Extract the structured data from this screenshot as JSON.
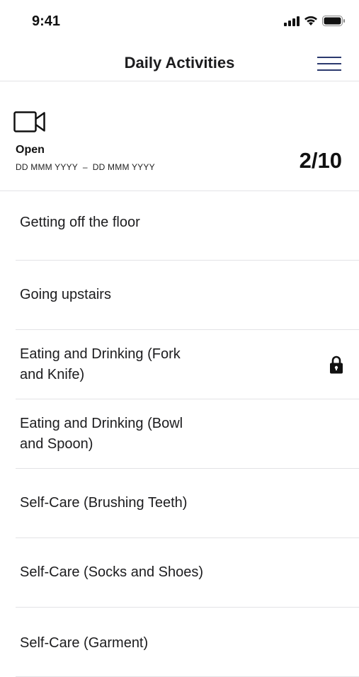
{
  "status_bar": {
    "time": "9:41",
    "icons": [
      "cellular-signal-icon",
      "wifi-icon",
      "battery-icon"
    ]
  },
  "nav": {
    "title": "Daily Activities",
    "menu_icon": "hamburger-menu-icon"
  },
  "summary": {
    "icon": "video-camera-icon",
    "status": "Open",
    "date_range": "DD MMM YYYY  –  DD MMM YYYY",
    "progress": "2/10"
  },
  "activities": [
    {
      "label": "Getting off the floor",
      "locked": false
    },
    {
      "label": "Going upstairs",
      "locked": false
    },
    {
      "label": "Eating and Drinking (Fork and Knife)",
      "locked": true
    },
    {
      "label": "Eating and Drinking (Bowl and Spoon)",
      "locked": false
    },
    {
      "label": "Self-Care (Brushing Teeth)",
      "locked": false
    },
    {
      "label": "Self-Care (Socks and Shoes)",
      "locked": false
    },
    {
      "label": "Self-Care (Garment)",
      "locked": false
    }
  ],
  "colors": {
    "accent": "#2b3a6e",
    "divider": "#e3e3e6",
    "text": "#1c1c1e"
  }
}
